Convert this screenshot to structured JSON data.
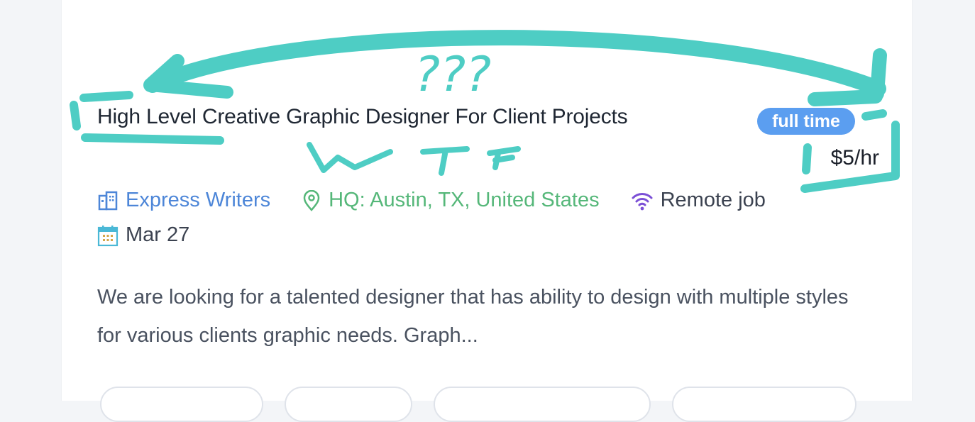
{
  "job": {
    "title": "High Level Creative Graphic Designer For Client Projects",
    "type_badge": "full time",
    "pay": "$5/hr",
    "company": "Express Writers",
    "location": "HQ: Austin, TX, United States",
    "remote": "Remote job",
    "date": "Mar 27",
    "description": "We are looking for a talented designer that has ability to design with multiple styles for various clients graphic needs. Graph..."
  },
  "annotations": {
    "question_marks": "???",
    "scribble_text": "WTF"
  },
  "icons": {
    "company": "building-icon",
    "location": "map-pin-icon",
    "remote": "wifi-icon",
    "date": "calendar-icon"
  },
  "colors": {
    "badge": "#5b9ef0",
    "company": "#4d86d8",
    "location": "#55b779",
    "remote_icon": "#7b4fd6",
    "annotation": "#4ecdc4"
  }
}
